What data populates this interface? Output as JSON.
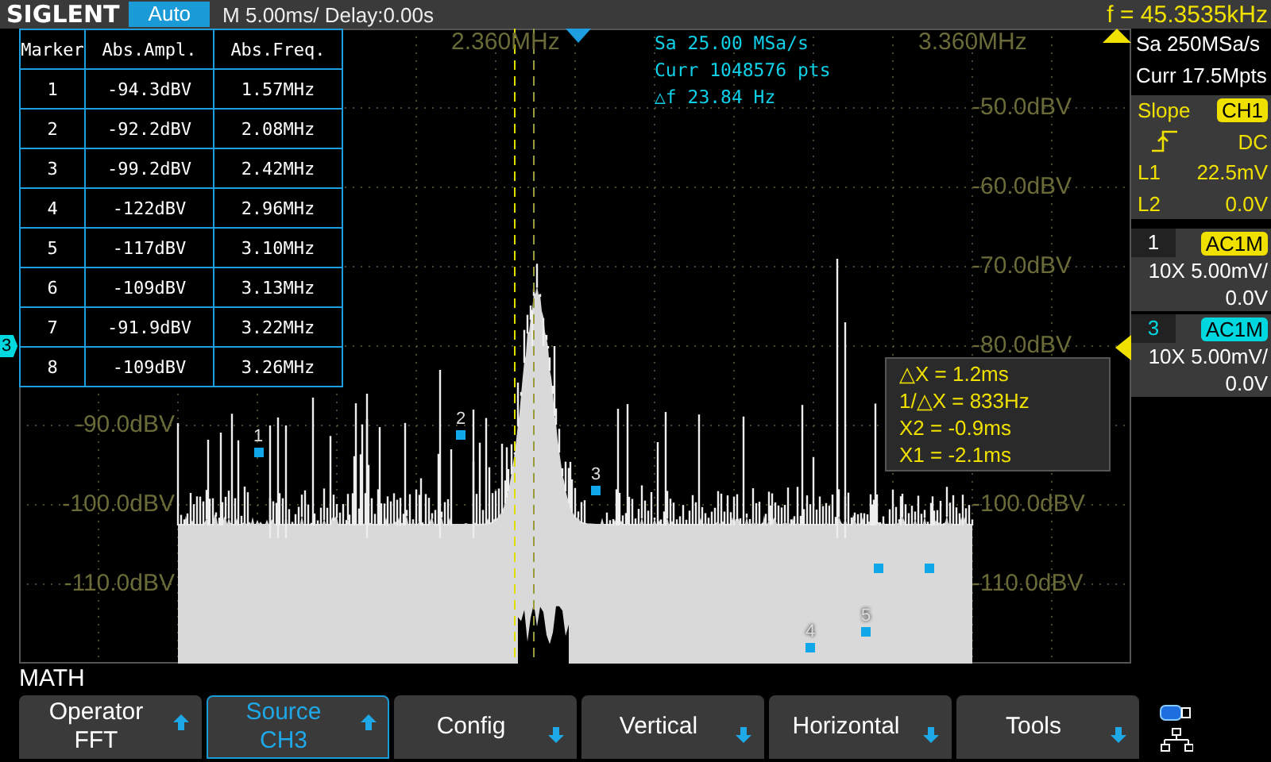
{
  "header": {
    "logo": "SIGLENT",
    "mode": "Auto",
    "timebase": "M 5.00ms/ Delay:0.00s",
    "frequency": "f = 45.3535kHz"
  },
  "plot": {
    "freq_labels": [
      "2.360MHz",
      "3.360MHz"
    ],
    "left_labels": [
      "-90.0dBV",
      "-100.0dBV",
      "-110.0dBV"
    ],
    "right_labels": [
      "-50.0dBV",
      "-60.0dBV",
      "-70.0dBV",
      "-80.0dBV",
      "-100.0dBV",
      "-110.0dBV"
    ],
    "fft_info": [
      "Sa 25.00 MSa/s",
      "Curr 1048576 pts",
      "△f 23.84 Hz"
    ],
    "cursor_readout": [
      "△X = 1.2ms",
      "1/△X = 833Hz",
      "X2 = -0.9ms",
      "X1 = -2.1ms"
    ],
    "channel_marker": "3",
    "marker_labels": [
      "1",
      "2",
      "3",
      "4",
      "5"
    ]
  },
  "marker_table": {
    "columns": [
      "Marker",
      "Abs.Ampl.",
      "Abs.Freq."
    ],
    "rows": [
      {
        "marker": "1",
        "ampl": "-94.3dBV",
        "freq": "1.57MHz"
      },
      {
        "marker": "2",
        "ampl": "-92.2dBV",
        "freq": "2.08MHz"
      },
      {
        "marker": "3",
        "ampl": "-99.2dBV",
        "freq": "2.42MHz"
      },
      {
        "marker": "4",
        "ampl": "-122dBV",
        "freq": "2.96MHz"
      },
      {
        "marker": "5",
        "ampl": "-117dBV",
        "freq": "3.10MHz"
      },
      {
        "marker": "6",
        "ampl": "-109dBV",
        "freq": "3.13MHz"
      },
      {
        "marker": "7",
        "ampl": "-91.9dBV",
        "freq": "3.22MHz"
      },
      {
        "marker": "8",
        "ampl": "-109dBV",
        "freq": "3.26MHz"
      }
    ]
  },
  "side_panel": {
    "sample_rate": "Sa 250MSa/s",
    "memory": "Curr 17.5Mpts",
    "trigger": {
      "slope_label": "Slope",
      "source": "CH1",
      "coupling": "DC",
      "levels": [
        {
          "name": "L1",
          "value": "22.5mV"
        },
        {
          "name": "L2",
          "value": "0.0V"
        }
      ]
    },
    "channels": [
      {
        "number": "1",
        "coupling": "AC1M",
        "probe": "10X",
        "scale": "5.00mV/",
        "offset": "0.0V",
        "color": "#f0e000"
      },
      {
        "number": "3",
        "coupling": "AC1M",
        "probe": "10X",
        "scale": "5.00mV/",
        "offset": "0.0V",
        "color": "#00d8e0"
      }
    ]
  },
  "menu": {
    "title": "MATH",
    "softkeys": [
      {
        "label": "Operator",
        "value": "FFT",
        "kind": "up",
        "selected": false
      },
      {
        "label": "Source",
        "value": "CH3",
        "kind": "up",
        "selected": true
      },
      {
        "label": "Config",
        "kind": "down",
        "selected": false
      },
      {
        "label": "Vertical",
        "kind": "down",
        "selected": false
      },
      {
        "label": "Horizontal",
        "kind": "down",
        "selected": false
      },
      {
        "label": "Tools",
        "kind": "down",
        "selected": false
      }
    ]
  }
}
